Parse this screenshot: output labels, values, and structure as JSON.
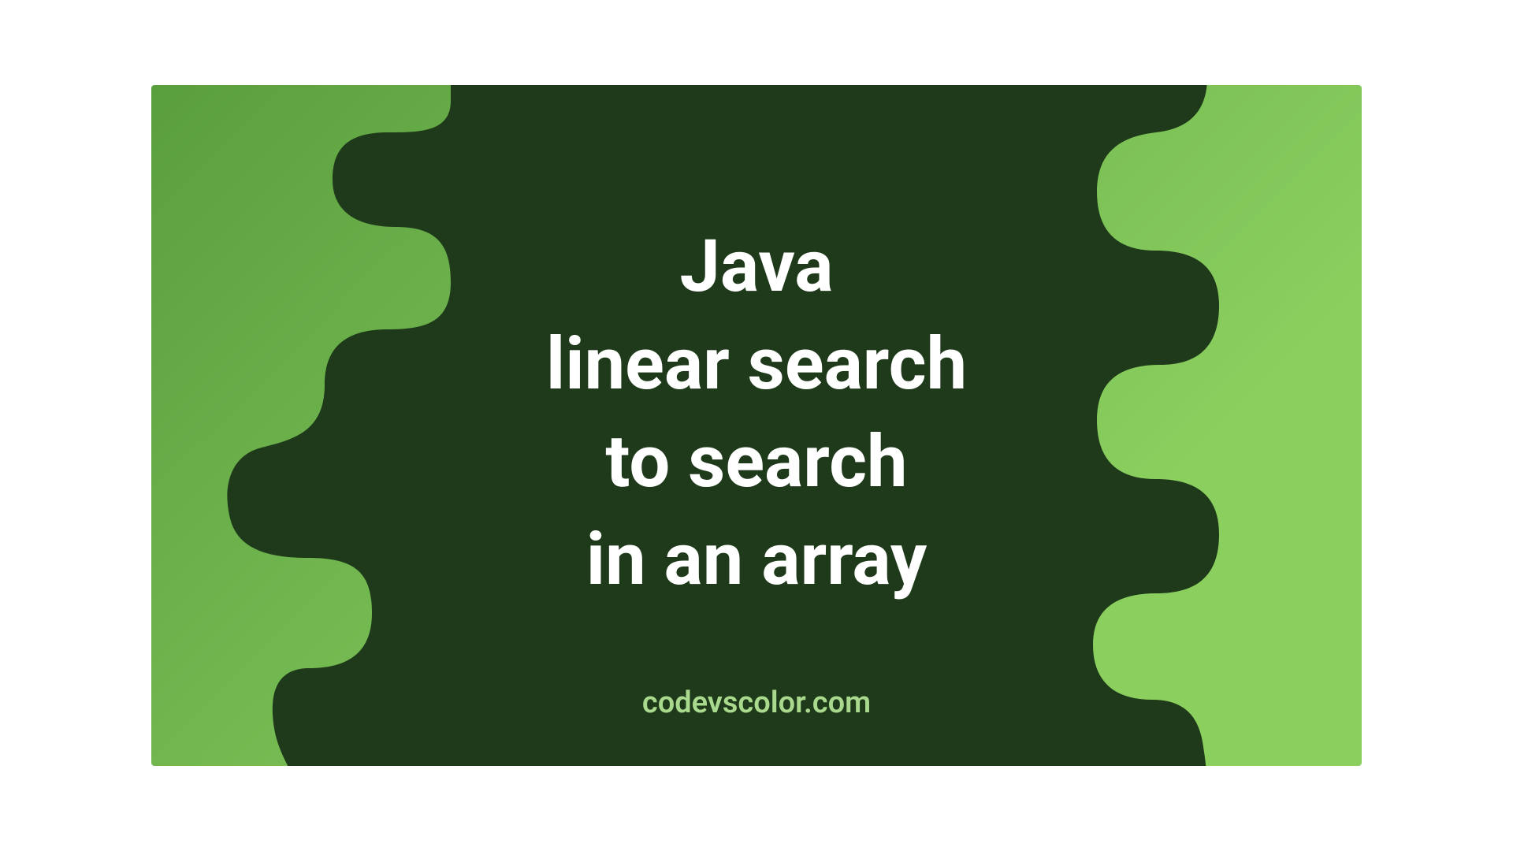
{
  "title": {
    "line1": "Java",
    "line2": "linear search",
    "line3": "to search",
    "line4": "in an array"
  },
  "footer": "codevscolor.com",
  "colors": {
    "blob": "#1e3a1a",
    "text": "#ffffff",
    "footer": "#a8d98c"
  }
}
